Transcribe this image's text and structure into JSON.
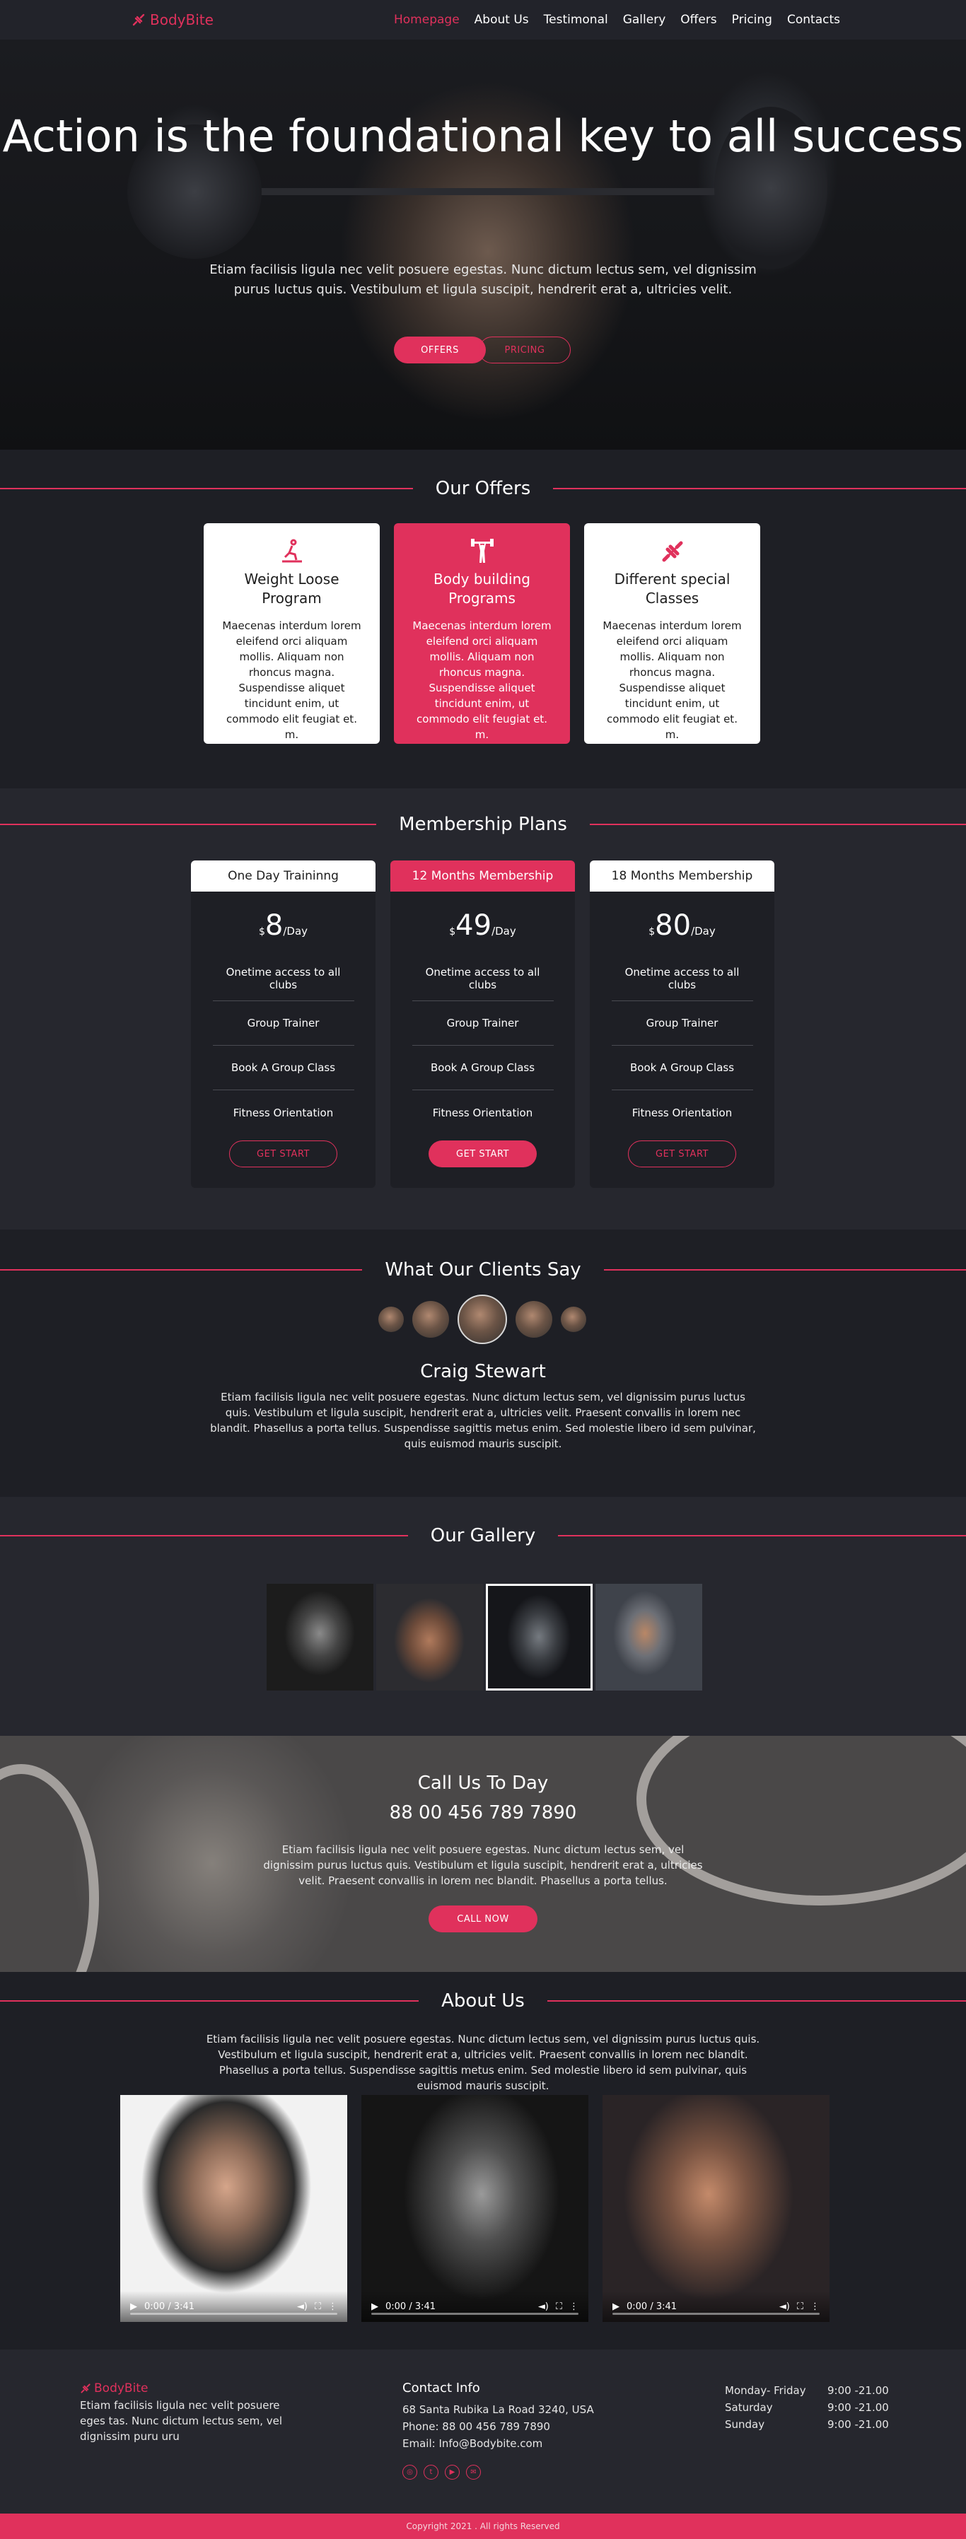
{
  "nav": {
    "logo": "BodyBite",
    "items": [
      "Homepage",
      "About Us",
      "Testimonal",
      "Gallery",
      "Offers",
      "Pricing",
      "Contacts"
    ],
    "active": "Homepage"
  },
  "hero": {
    "title": "Action is the foundational key to all success",
    "text": "Etiam facilisis ligula nec velit posuere egestas. Nunc dictum lectus sem, vel dignissim purus luctus quis. Vestibulum et ligula suscipit, hendrerit erat a, ultricies velit.",
    "btn_offers": "OFFERS",
    "btn_pricing": "PRICING"
  },
  "offers": {
    "title": "Our Offers",
    "cards": [
      {
        "title": "Weight Loose Program",
        "text": "Maecenas interdum lorem eleifend orci aliquam mollis. Aliquam non rhoncus magna. Suspendisse aliquet tincidunt enim, ut commodo elit feugiat et. m.",
        "icon": "treadmill-icon"
      },
      {
        "title": "Body building Programs",
        "text": "Maecenas interdum lorem eleifend orci aliquam mollis. Aliquam non rhoncus magna. Suspendisse aliquet tincidunt enim, ut commodo elit feugiat et. m.",
        "icon": "weightlifter-icon"
      },
      {
        "title": "Different special Classes",
        "text": "Maecenas interdum lorem eleifend orci aliquam mollis. Aliquam non rhoncus magna. Suspendisse aliquet tincidunt enim, ut commodo elit feugiat et. m.",
        "icon": "dumbbell-icon"
      }
    ]
  },
  "plans": {
    "title": "Membership Plans",
    "items": [
      {
        "name": "One Day Traininng",
        "currency": "$",
        "price": "8",
        "per": "/Day",
        "features": [
          "Onetime access to all clubs",
          "Group Trainer",
          "Book A Group Class",
          "Fitness Orientation"
        ],
        "button": "GET START"
      },
      {
        "name": "12 Months Membership",
        "currency": "$",
        "price": "49",
        "per": "/Day",
        "features": [
          "Onetime access to all clubs",
          "Group Trainer",
          "Book A Group Class",
          "Fitness Orientation"
        ],
        "button": "GET START"
      },
      {
        "name": "18 Months Membership",
        "currency": "$",
        "price": "80",
        "per": "/Day",
        "features": [
          "Onetime access to all clubs",
          "Group Trainer",
          "Book A Group Class",
          "Fitness Orientation"
        ],
        "button": "GET START"
      }
    ]
  },
  "testimonials": {
    "title": "What Our Clients Say",
    "name": "Craig Stewart",
    "text": "Etiam facilisis ligula nec velit posuere egestas. Nunc dictum lectus sem, vel dignissim purus luctus quis. Vestibulum et ligula suscipit, hendrerit erat a, ultricies velit. Praesent convallis in lorem nec blandit. Phasellus a porta tellus. Suspendisse sagittis metus enim. Sed molestie libero id sem pulvinar, quis euismod mauris suscipit."
  },
  "gallery": {
    "title": "Our Gallery"
  },
  "callus": {
    "title": "Call Us To Day",
    "phone": "88 00 456 789 7890",
    "text": "Etiam facilisis ligula nec velit posuere egestas. Nunc dictum lectus sem, vel dignissim purus luctus quis. Vestibulum et ligula suscipit, hendrerit erat a, ultricies velit. Praesent convallis in lorem nec blandit. Phasellus a porta tellus.",
    "button": "CALL NOW"
  },
  "about": {
    "title": "About Us",
    "text": "Etiam facilisis ligula nec velit posuere egestas. Nunc dictum lectus sem, vel dignissim purus luctus quis. Vestibulum et ligula suscipit, hendrerit erat a, ultricies velit. Praesent convallis in lorem nec blandit. Phasellus a porta tellus. Suspendisse sagittis metus enim. Sed molestie libero id sem pulvinar, quis euismod mauris suscipit.",
    "video_time": "0:00 / 3:41"
  },
  "footer": {
    "logo": "BodyBite",
    "text": "Etiam facilisis ligula nec velit posuere eges tas. Nunc dictum lectus sem, vel dignissim puru uru",
    "contact_title": "Contact Info",
    "address": "68 Santa Rubika La Road 3240, USA",
    "phone": "Phone: 88 00 456 789 7890",
    "email": "Email: Info@Bodybite.com",
    "hours": [
      {
        "day": "Monday- Friday",
        "time": "9:00 -21.00"
      },
      {
        "day": "Saturday",
        "time": "9:00 -21.00"
      },
      {
        "day": "Sunday",
        "time": "9:00 -21.00"
      }
    ],
    "copyright": "Copyright 2021 . All rights Reserved"
  },
  "colors": {
    "accent": "#e0315c",
    "bg_dark": "#1e1f25",
    "bg_alt": "#26272e"
  }
}
